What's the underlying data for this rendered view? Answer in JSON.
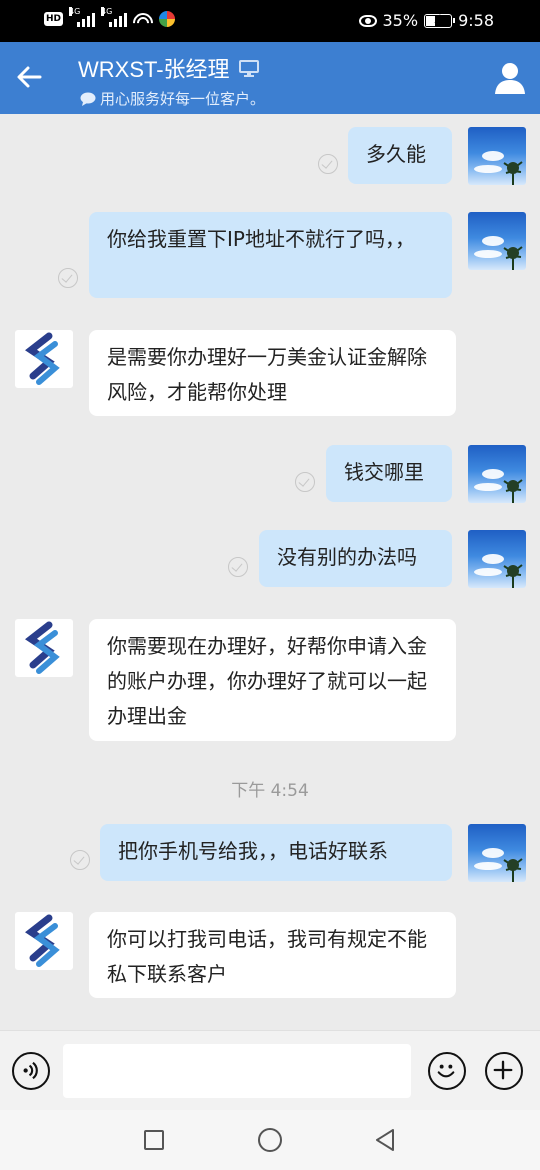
{
  "status_bar": {
    "hd_label": "HD",
    "network_1": "4G",
    "network_2": "4G",
    "battery_percent": "35%",
    "battery_level": 0.35,
    "time": "9:58"
  },
  "header": {
    "title": "WRXST-张经理",
    "subtitle": "用心服务好每一位客户。",
    "icons": {
      "back": "back-arrow-icon",
      "device": "desktop-icon",
      "status": "chat-bubble-icon",
      "profile": "person-icon"
    },
    "colors": {
      "bar": "#3d7fd1"
    }
  },
  "messages": [
    {
      "sender": "me",
      "text": "多久能"
    },
    {
      "sender": "me",
      "text": "你给我重置下IP地址不就行了吗，，"
    },
    {
      "sender": "agent",
      "text": "是需要你办理好一万美金认证金解除风险，才能帮你处理"
    },
    {
      "sender": "me",
      "text": "钱交哪里"
    },
    {
      "sender": "me",
      "text": "没有别的办法吗"
    },
    {
      "sender": "agent",
      "text": "你需要现在办理好，好帮你申请入金的账户办理，你办理好了就可以一起办理出金"
    },
    {
      "sender": "me",
      "text": "把你手机号给我，，电话好联系"
    },
    {
      "sender": "agent",
      "text": "你可以打我司电话，我司有规定不能私下联系客户"
    }
  ],
  "timestamp": "下午 4:54",
  "input_bar": {
    "message_value": "",
    "icons": {
      "voice": "voice-icon",
      "emoji": "smiley-icon",
      "add": "plus-icon"
    }
  },
  "nav_bar": {
    "icons": {
      "recents": "square-icon",
      "home": "circle-icon",
      "back": "triangle-back-icon"
    }
  },
  "colors": {
    "my_bubble": "#cde6fb",
    "their_bubble": "#ffffff",
    "chat_background": "#ebebeb"
  }
}
